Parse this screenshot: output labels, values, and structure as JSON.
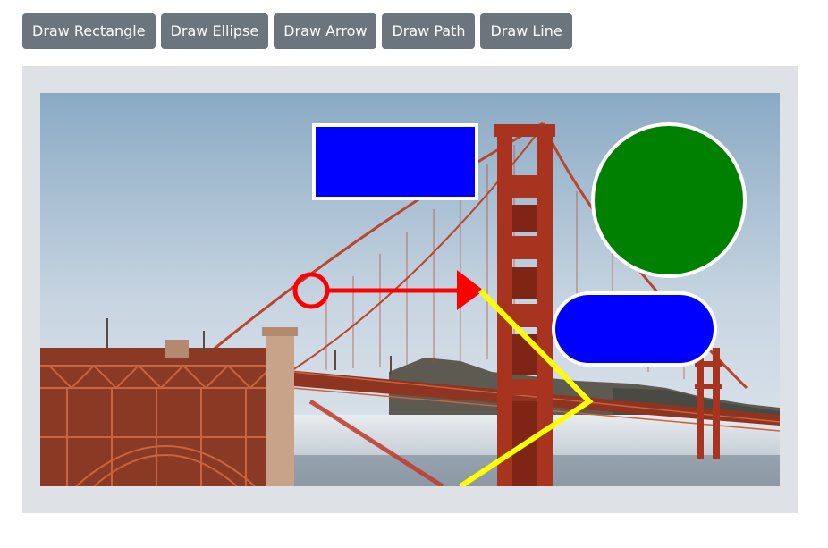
{
  "toolbar": {
    "buttons": [
      {
        "label": "Draw Rectangle"
      },
      {
        "label": "Draw Ellipse"
      },
      {
        "label": "Draw Arrow"
      },
      {
        "label": "Draw Path"
      },
      {
        "label": "Draw Line"
      }
    ]
  },
  "canvas": {
    "background_image": "golden-gate-bridge-photo",
    "shapes": {
      "rectangle_fill": "#0000ff",
      "circle_fill": "#008000",
      "rounded_rect_fill": "#0000ff",
      "arrow_color": "#ff0000",
      "path_color": "#ffff00",
      "line_color": "#c0392b",
      "outline_color": "#ffffff"
    }
  }
}
